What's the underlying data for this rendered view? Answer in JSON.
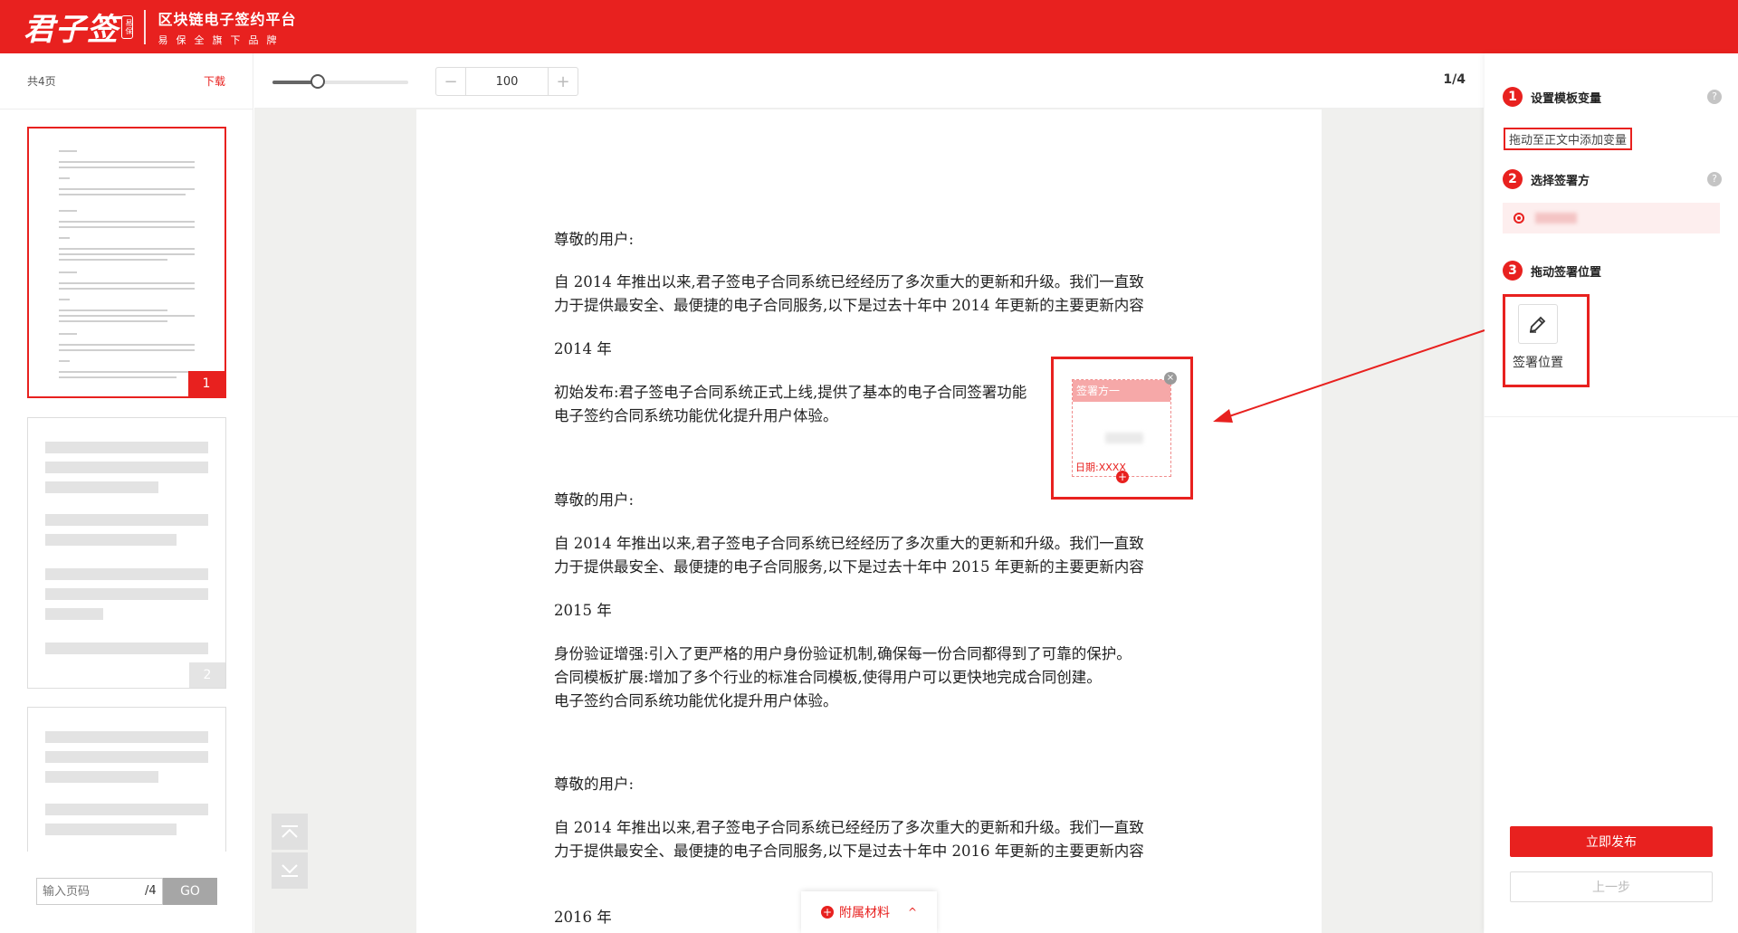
{
  "header": {
    "logo_text": "君子签",
    "logo_seal": "易保",
    "platform_title": "区块链电子签约平台",
    "platform_sub": "易保全旗下品牌"
  },
  "left": {
    "page_count": "共4页",
    "download": "下载",
    "thumb1_num": "1",
    "thumb2_num": "2",
    "goto_placeholder": "输入页码",
    "goto_total": "/4",
    "goto_button": "GO"
  },
  "toolbar": {
    "zoom_minus": "−",
    "zoom_value": "100",
    "zoom_plus": "+",
    "page_indicator": "1/4"
  },
  "document": {
    "p1": "尊敬的用户:",
    "p2a": "自 2014 年推出以来,君子签电子合同系统已经经历了多次重大的更新和升级。我们一直致",
    "p2b": "力于提供最安全、最便捷的电子合同服务,以下是过去十年中 2014 年更新的主要更新内容",
    "p3": "2014 年",
    "p4a": "初始发布:君子签电子合同系统正式上线,提供了基本的电子合同签署功能",
    "p4b": "电子签约合同系统功能优化提升用户体验。",
    "p5": "尊敬的用户:",
    "p6a": "自 2014 年推出以来,君子签电子合同系统已经经历了多次重大的更新和升级。我们一直致",
    "p6b": "力于提供最安全、最便捷的电子合同服务,以下是过去十年中 2015 年更新的主要更新内容",
    "p7": "2015 年",
    "p8a": "身份验证增强:引入了更严格的用户身份验证机制,确保每一份合同都得到了可靠的保护。",
    "p8b": "合同模板扩展:增加了多个行业的标准合同模板,使得用户可以更快地完成合同创建。",
    "p8c": "电子签约合同系统功能优化提升用户体验。",
    "p9": "尊敬的用户:",
    "p10a": "自 2014 年推出以来,君子签电子合同系统已经经历了多次重大的更新和升级。我们一直致",
    "p10b": "力于提供最安全、最便捷的电子合同服务,以下是过去十年中 2016 年更新的主要更新内容",
    "p11": "2016 年"
  },
  "signature_field": {
    "title": "签署方一",
    "date_label": "日期:XXXX",
    "close": "×",
    "move": "+"
  },
  "attachments": {
    "label": "附属材料",
    "icon": "+",
    "chevron": "^"
  },
  "right": {
    "step1_num": "1",
    "step1_title": "设置模板变量",
    "step1_tag": "拖动至正文中添加变量",
    "step2_num": "2",
    "step2_title": "选择签署方",
    "step3_num": "3",
    "step3_title": "拖动签署位置",
    "sig_position_label": "签署位置",
    "help": "?",
    "publish": "立即发布",
    "prev": "上一步"
  },
  "colors": {
    "brand": "#e8211f"
  }
}
